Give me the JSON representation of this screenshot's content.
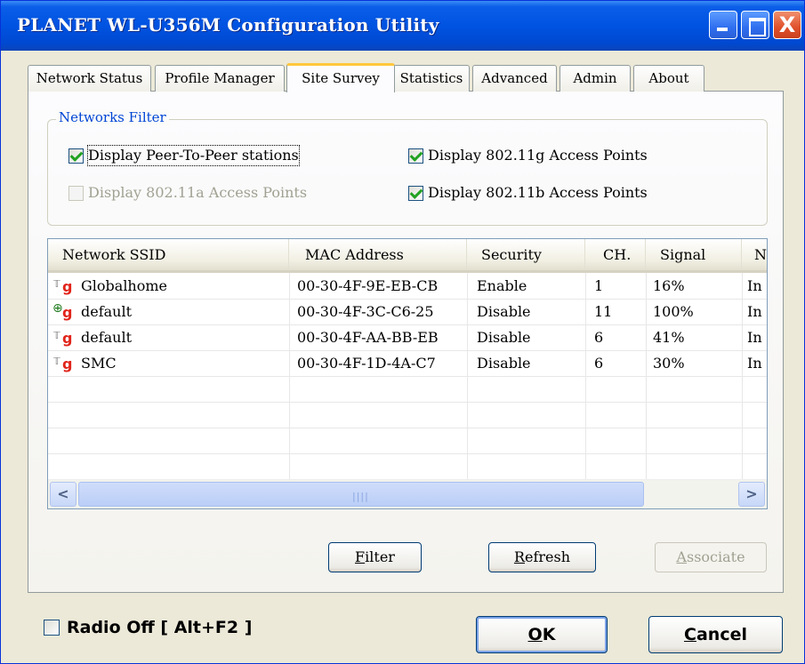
{
  "window": {
    "title": "PLANET WL-U356M Configuration Utility",
    "close_glyph": "X"
  },
  "tabs": [
    {
      "label": "Network Status"
    },
    {
      "label": "Profile Manager"
    },
    {
      "label": "Site Survey",
      "active": true
    },
    {
      "label": "Statistics"
    },
    {
      "label": "Advanced"
    },
    {
      "label": "Admin"
    },
    {
      "label": "About"
    }
  ],
  "filter": {
    "legend": "Networks Filter",
    "peer_to_peer": {
      "label": "Display Peer-To-Peer stations",
      "checked": true
    },
    "ap_80211a": {
      "label": "Display 802.11a Access Points",
      "checked": false,
      "enabled": false
    },
    "ap_80211g": {
      "label": "Display 802.11g Access Points",
      "checked": true
    },
    "ap_80211b": {
      "label": "Display 802.11b Access Points",
      "checked": true
    }
  },
  "table": {
    "columns": [
      "Network SSID",
      "MAC Address",
      "Security",
      "CH.",
      "Signal",
      "N"
    ],
    "rows": [
      {
        "icon": "infrastructure-g-icon",
        "badge": "g",
        "ssid": "Globalhome",
        "mac": "00-30-4F-9E-EB-CB",
        "security": "Enable",
        "channel": "1",
        "signal": "16%",
        "next": "In"
      },
      {
        "icon": "adhoc-g-icon",
        "badge": "g",
        "ssid": "default",
        "mac": "00-30-4F-3C-C6-25",
        "security": "Disable",
        "channel": "11",
        "signal": "100%",
        "next": "In"
      },
      {
        "icon": "infrastructure-g-icon",
        "badge": "g",
        "ssid": "default",
        "mac": "00-30-4F-AA-BB-EB",
        "security": "Disable",
        "channel": "6",
        "signal": "41%",
        "next": "In"
      },
      {
        "icon": "infrastructure-g-icon",
        "badge": "g",
        "ssid": "SMC",
        "mac": "00-30-4F-1D-4A-C7",
        "security": "Disable",
        "channel": "6",
        "signal": "30%",
        "next": "In"
      }
    ],
    "scrollbar": {
      "left_glyph": "<",
      "right_glyph": ">",
      "grip": "||||"
    }
  },
  "buttons": {
    "filter": {
      "mnemonic": "F",
      "rest": "ilter"
    },
    "refresh": {
      "mnemonic": "R",
      "rest": "efresh"
    },
    "associate": {
      "mnemonic": "A",
      "rest": "ssociate",
      "enabled": false
    },
    "ok": {
      "mnemonic": "O",
      "rest": "K"
    },
    "cancel": {
      "mnemonic": "C",
      "rest": "ancel"
    }
  },
  "radio_off": {
    "label": "Radio Off  [ Alt+F2 ]",
    "checked": false
  },
  "colors": {
    "title_bar": "#0053e1",
    "legend": "#0046d5",
    "checkmark": "#21a121",
    "badge_g": "#e1251b"
  }
}
